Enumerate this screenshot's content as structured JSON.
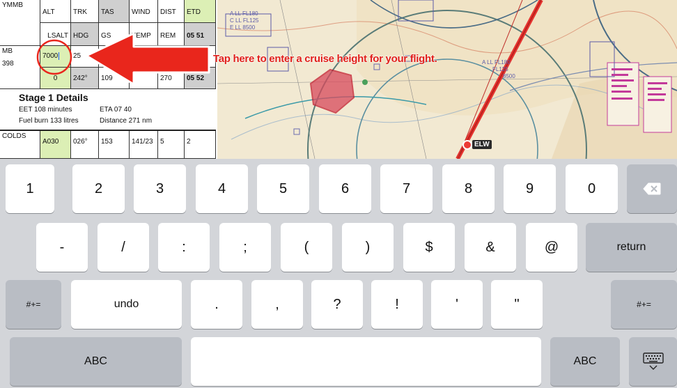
{
  "navlog": {
    "header_row1": [
      "YMMB",
      "ALT",
      "TRK",
      "TAS",
      "WIND",
      "DIST",
      "ETD"
    ],
    "header_row2": [
      "LSALT",
      "HDG",
      "GS",
      "TEMP",
      "REM",
      "05 51"
    ],
    "leg_row1": {
      "from": "MB",
      "alt_value": "7000",
      "trk": "25"
    },
    "leg_row2": {
      "elev": "398",
      "lsalt": "0",
      "hdg": "242°",
      "gs": "109",
      "rem": "270",
      "time": "05 52"
    },
    "stage": {
      "title": "Stage 1 Details",
      "eet": "EET 108 minutes",
      "eta": "ETA 07 40",
      "fuel": "Fuel burn 133 litres",
      "distance": "Distance 271 nm"
    },
    "leg_row3": [
      "COLDS",
      "A030",
      "026°",
      "153",
      "141/23",
      "5",
      "2"
    ]
  },
  "map": {
    "labels": {
      "fl180": "A LL FL180",
      "fl125": "C LL FL125",
      "a8500": "E LL 8500",
      "r_fl180": "A LL FL180",
      "r_fl125": "FL125",
      "r_8500": "8500",
      "elw": "ELW"
    }
  },
  "overlay": {
    "callout": "Tap here to enter a cruise height for your flight."
  },
  "keyboard": {
    "row1": [
      "1",
      "2",
      "3",
      "4",
      "5",
      "6",
      "7",
      "8",
      "9",
      "0"
    ],
    "row2": [
      "-",
      "/",
      ":",
      ";",
      "(",
      ")",
      "$",
      "&",
      "@"
    ],
    "return_label": "return",
    "row3_left": "#+=",
    "undo": "undo",
    "row3_keys": [
      ".",
      ",",
      "?",
      "!",
      "'",
      "\""
    ],
    "row3_right": "#+=",
    "abc_left": "ABC",
    "abc_right": "ABC"
  },
  "colors": {
    "accent_red": "#e1201b",
    "cell_green": "#dcefb5",
    "cell_gray": "#cfcfcf"
  }
}
